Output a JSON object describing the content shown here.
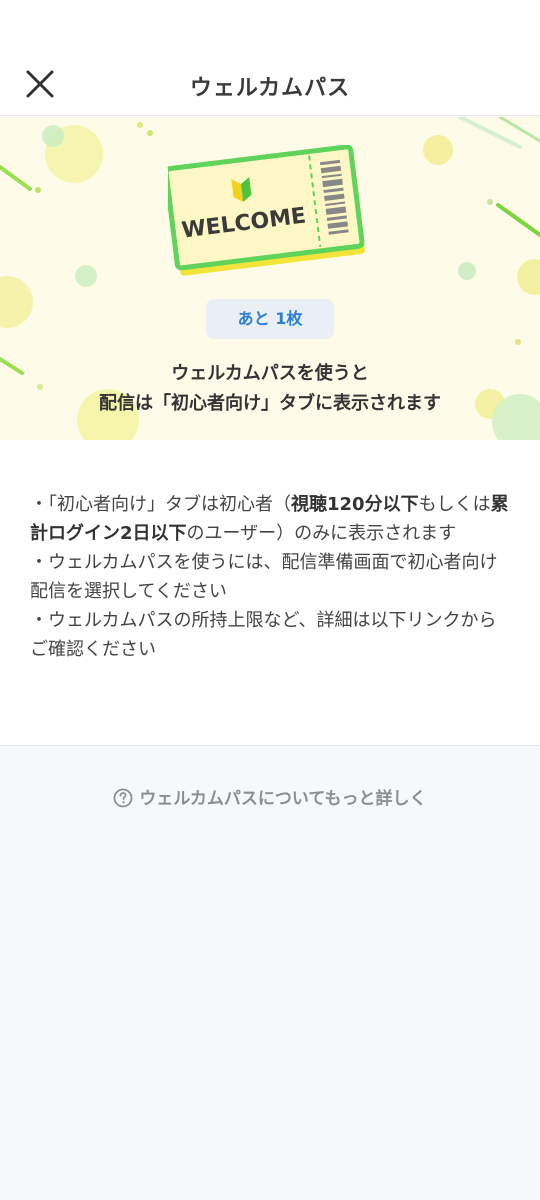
{
  "header": {
    "title": "ウェルカムパス",
    "close_icon": "close-icon"
  },
  "hero": {
    "ticket_text": "WELCOME",
    "ticket_icon": "beginner-mark-icon",
    "remaining": "あと 1枚",
    "line1": "ウェルカムパスを使うと",
    "line2": "配信は「初心者向け」タブに表示されます",
    "colors": {
      "background": "#fefbe9",
      "ticket_border": "#5fd35a",
      "ticket_fill": "#fdf7c6",
      "badge_text": "#2a7fd4"
    }
  },
  "info": {
    "item1": {
      "pre": "・「初心者向け」タブは初心者（",
      "bold1": "視聴120分以下",
      "mid": "もしくは",
      "bold2": "累計ログイン2日以下",
      "post": "のユーザー）のみに表示されます"
    },
    "item2": "・ウェルカムパスを使うには、配信準備画面で初心者向け配信を選択してください",
    "item3": "・ウェルカムパスの所持上限など、詳細は以下リンクからご確認ください"
  },
  "more": {
    "label": "ウェルカムパスについてもっと詳しく",
    "icon": "question-circle-icon"
  }
}
